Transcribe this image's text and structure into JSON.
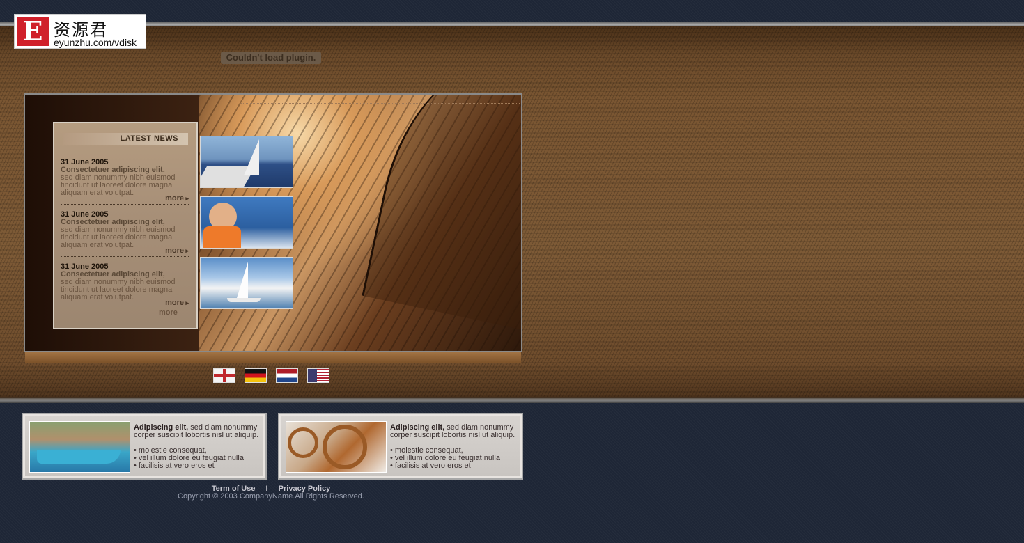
{
  "logo": {
    "mark": "E",
    "chinese": "资源君",
    "url": "eyunzhu.com/vdisk"
  },
  "plugin_message": "Couldn't load plugin.",
  "news": {
    "title": "LATEST NEWS",
    "items": [
      {
        "date": "31 June 2005",
        "headline": "Consectetuer adipiscing elit,",
        "text": "sed diam nonummy nibh euismod tincidunt ut laoreet dolore magna aliquam erat volutpat.",
        "more": "more"
      },
      {
        "date": "31 June 2005",
        "headline": "Consectetuer adipiscing elit,",
        "text": "sed diam nonummy nibh euismod tincidunt ut laoreet dolore magna aliquam erat volutpat.",
        "more": "more"
      },
      {
        "date": "31 June 2005",
        "headline": "Consectetuer adipiscing elit,",
        "text": "sed diam nonummy nibh euismod tincidunt ut laoreet dolore magna aliquam erat volutpat.",
        "more": "more"
      }
    ],
    "ghost_more": "more"
  },
  "flags": [
    {
      "name": "uk-flag"
    },
    {
      "name": "germany-flag"
    },
    {
      "name": "netherlands-flag"
    },
    {
      "name": "us-flag"
    }
  ],
  "boxes": [
    {
      "lead": "Adipiscing elit,",
      "text": " sed diam nonummy corper suscipit lobortis nisl ut aliquip.",
      "bullets": [
        "• molestie consequat,",
        "• vel illum dolore eu feugiat nulla",
        "• facilisis at vero eros et"
      ]
    },
    {
      "lead": "Adipiscing elit,",
      "text": " sed diam nonummy corper suscipit lobortis nisl ut aliquip.",
      "bullets": [
        "• molestie consequat,",
        "• vel illum dolore eu feugiat nulla",
        "• facilisis at vero eros et"
      ]
    }
  ],
  "footer": {
    "terms": "Term of Use",
    "separator": "I",
    "privacy": "Privacy Policy",
    "copyright": "Copyright © 2003 CompanyName.All Rights Reserved."
  }
}
